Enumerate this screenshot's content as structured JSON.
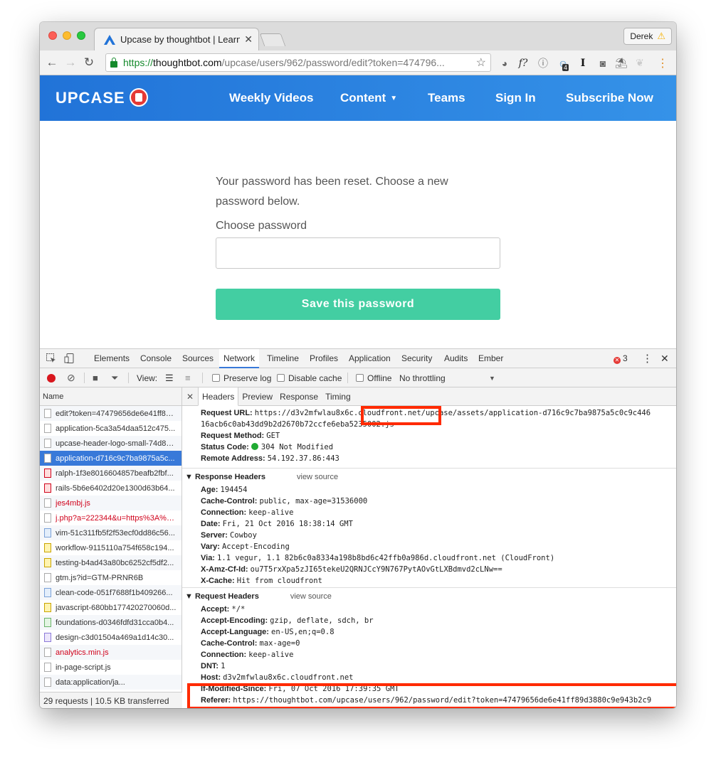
{
  "browser": {
    "tab_title": "Upcase by thoughtbot | Learn",
    "profile_name": "Derek",
    "url_scheme": "https://",
    "url_host": "thoughtbot.com",
    "url_path": "/upcase/users/962/password/edit?token=474796...",
    "ext_badge": "4"
  },
  "site": {
    "logo": "UPCASE",
    "nav": [
      "Weekly Videos",
      "Content",
      "Teams",
      "Sign In",
      "Subscribe Now"
    ]
  },
  "page": {
    "message": "Your password has been reset. Choose a new password below.",
    "password_label": "Choose password",
    "save_button": "Save this password"
  },
  "devtools": {
    "tabs": [
      "Elements",
      "Console",
      "Sources",
      "Network",
      "Timeline",
      "Profiles",
      "Application",
      "Security",
      "Audits",
      "Ember"
    ],
    "active_tab": "Network",
    "error_count": "3",
    "toolbar": {
      "view_label": "View:",
      "preserve_log": "Preserve log",
      "disable_cache": "Disable cache",
      "offline": "Offline",
      "throttling": "No throttling"
    },
    "name_header": "Name",
    "requests": [
      {
        "name": "edit?token=47479656de6e41ff89...",
        "icon": "doc",
        "color": ""
      },
      {
        "name": "application-5ca3a54daa512c475...",
        "icon": "doc",
        "color": ""
      },
      {
        "name": "upcase-header-logo-small-74d88...",
        "icon": "doc",
        "color": ""
      },
      {
        "name": "application-d716c9c7ba9875a5c...",
        "icon": "doc",
        "color": "selected"
      },
      {
        "name": "ralph-1f3e8016604857beafb2fbf...",
        "icon": "red",
        "color": ""
      },
      {
        "name": "rails-5b6e6402d20e1300d63b64...",
        "icon": "red",
        "color": ""
      },
      {
        "name": "jes4mbj.js",
        "icon": "doc",
        "color": "red"
      },
      {
        "name": "j.php?a=222344&u=https%3A%2...",
        "icon": "doc",
        "color": "red"
      },
      {
        "name": "vim-51c311fb5f2f53ecf0dd86c56...",
        "icon": "blue",
        "color": ""
      },
      {
        "name": "workflow-9115110a754f658c194...",
        "icon": "yellow",
        "color": ""
      },
      {
        "name": "testing-b4ad43a80bc6252cf5df2...",
        "icon": "yellow",
        "color": ""
      },
      {
        "name": "gtm.js?id=GTM-PRNR6B",
        "icon": "doc",
        "color": ""
      },
      {
        "name": "clean-code-051f7688f1b409266...",
        "icon": "blue",
        "color": ""
      },
      {
        "name": "javascript-680bb177420270060d...",
        "icon": "yellow",
        "color": ""
      },
      {
        "name": "foundations-d0346fdfd31cca0b4...",
        "icon": "green",
        "color": ""
      },
      {
        "name": "design-c3d01504a469a1d14c30...",
        "icon": "purple",
        "color": ""
      },
      {
        "name": "analytics.min.js",
        "icon": "doc",
        "color": "red"
      },
      {
        "name": "in-page-script.js",
        "icon": "doc",
        "color": ""
      },
      {
        "name": "data:application/ja...",
        "icon": "doc",
        "color": ""
      }
    ],
    "status": "29 requests  |  10.5 KB transferred",
    "detail_tabs": [
      "Headers",
      "Preview",
      "Response",
      "Timing"
    ],
    "general": [
      {
        "k": "Request URL:",
        "v": "https://d3v2mfwlau8x6c.cloudfront.net/upcase/assets/application-d716c9c7ba9875a5c0c9c446"
      },
      {
        "k": "",
        "v": "16acb6c0ab43dd9b2d2670b72ccfe6eba5235002.js"
      },
      {
        "k": "Request Method:",
        "v": "GET"
      },
      {
        "k": "Status Code:",
        "v": "304 Not Modified"
      },
      {
        "k": "Remote Address:",
        "v": "54.192.37.86:443"
      }
    ],
    "response_headers_title": "Response Headers",
    "view_source": "view source",
    "response_headers": [
      {
        "k": "Age:",
        "v": "194454"
      },
      {
        "k": "Cache-Control:",
        "v": "public, max-age=31536000"
      },
      {
        "k": "Connection:",
        "v": "keep-alive"
      },
      {
        "k": "Date:",
        "v": "Fri, 21 Oct 2016 18:38:14 GMT"
      },
      {
        "k": "Server:",
        "v": "Cowboy"
      },
      {
        "k": "Vary:",
        "v": "Accept-Encoding"
      },
      {
        "k": "Via:",
        "v": "1.1 vegur, 1.1 82b6c0a8334a198b8bd6c42ffb0a986d.cloudfront.net (CloudFront)"
      },
      {
        "k": "X-Amz-Cf-Id:",
        "v": "ou7T5rxXpa5zJI65tekeU2QRNJCcY9N767PytAOvGtLXBdmvd2cLNw=="
      },
      {
        "k": "X-Cache:",
        "v": "Hit from cloudfront"
      }
    ],
    "request_headers_title": "Request Headers",
    "request_headers": [
      {
        "k": "Accept:",
        "v": "*/*"
      },
      {
        "k": "Accept-Encoding:",
        "v": "gzip, deflate, sdch, br"
      },
      {
        "k": "Accept-Language:",
        "v": "en-US,en;q=0.8"
      },
      {
        "k": "Cache-Control:",
        "v": "max-age=0"
      },
      {
        "k": "Connection:",
        "v": "keep-alive"
      },
      {
        "k": "DNT:",
        "v": "1"
      },
      {
        "k": "Host:",
        "v": "d3v2mfwlau8x6c.cloudfront.net"
      },
      {
        "k": "If-Modified-Since:",
        "v": "Fri, 07 Oct 2016 17:39:35 GMT"
      },
      {
        "k": "Referer:",
        "v": "https://thoughtbot.com/upcase/users/962/password/edit?token=47479656de6e41ff89d3880c9e943b2c9"
      }
    ]
  },
  "colors": {
    "header_blue": "#2173d8",
    "save_green": "#43cea2",
    "highlight_red": "#ff2a00",
    "selected_blue": "#3879d9"
  }
}
